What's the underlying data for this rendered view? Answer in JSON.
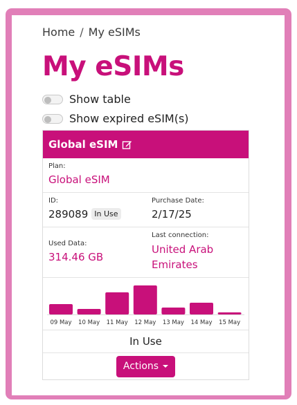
{
  "breadcrumb": {
    "home": "Home",
    "separator": "/",
    "current": "My eSIMs"
  },
  "page_title": "My eSIMs",
  "toggles": {
    "show_table": "Show table",
    "show_expired": "Show expired eSIM(s)"
  },
  "card": {
    "title": "Global eSIM",
    "plan_label": "Plan:",
    "plan_value": "Global eSIM",
    "id_label": "ID:",
    "id_value": "289089",
    "id_badge": "In Use",
    "purchase_label": "Purchase Date:",
    "purchase_value": "2/17/25",
    "used_label": "Used Data:",
    "used_value": "314.46 GB",
    "last_label": "Last connection:",
    "last_value_line1": "United Arab",
    "last_value_line2": "Emirates",
    "status": "In Use",
    "actions_label": "Actions"
  },
  "colors": {
    "accent": "#c8107a",
    "frame": "#e17fb8"
  },
  "chart_data": {
    "type": "bar",
    "categories": [
      "09 May",
      "10 May",
      "11 May",
      "12 May",
      "13 May",
      "14 May",
      "15 May"
    ],
    "values": [
      15,
      8,
      32,
      42,
      10,
      17,
      3
    ],
    "ylim": [
      0,
      42
    ],
    "grid": false,
    "color": "#c8107a"
  }
}
